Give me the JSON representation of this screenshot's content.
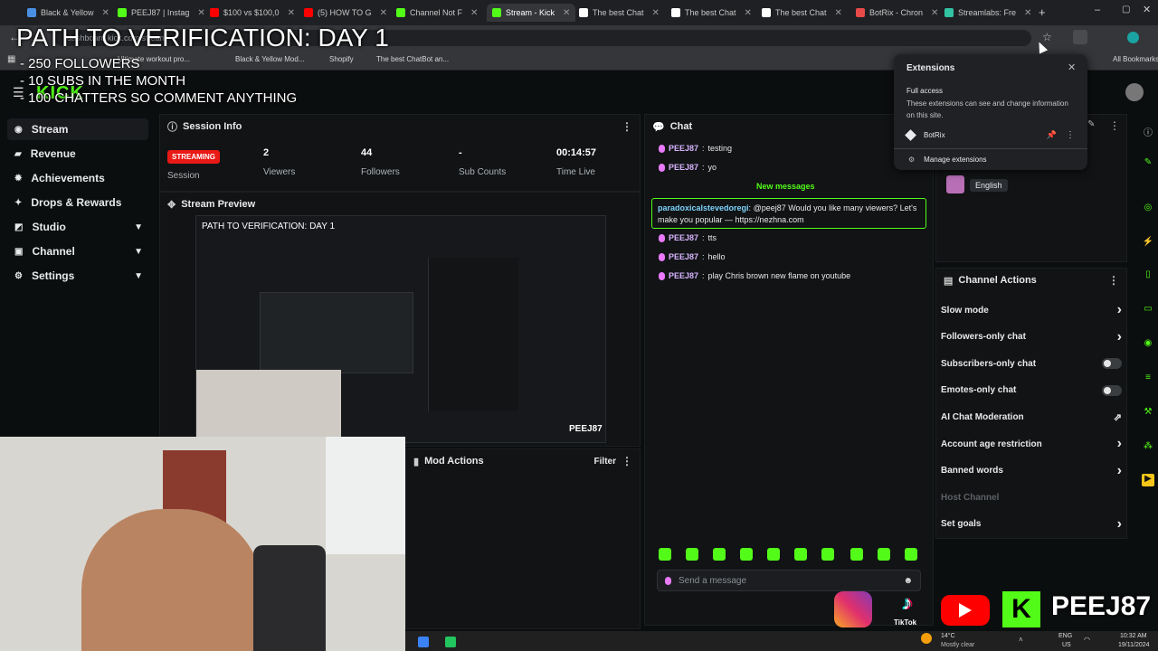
{
  "browser": {
    "tabs": [
      {
        "label": "Black & Yellow",
        "color": "#4a90e2"
      },
      {
        "label": "PEEJ87 | Instag",
        "color": "#53fc18"
      },
      {
        "label": "$100 vs $100,0",
        "color": "#ff0000"
      },
      {
        "label": "(5) HOW TO G",
        "color": "#ff0000"
      },
      {
        "label": "Channel Not F",
        "color": "#53fc18"
      },
      {
        "label": "Stream - Kick",
        "color": "#53fc18",
        "active": true
      },
      {
        "label": "The best Chat",
        "color": "#ffffff"
      },
      {
        "label": "The best Chat",
        "color": "#ffffff"
      },
      {
        "label": "The best Chat",
        "color": "#ffffff"
      },
      {
        "label": "BotRix - Chron",
        "color": "#e84a4a"
      },
      {
        "label": "Streamlabs: Fre",
        "color": "#31c3a2"
      }
    ],
    "url": "dashboard.kick.com/stream",
    "bookmarks": [
      "Ultimate workout pro...",
      "Black & Yellow Mod...",
      "Shopify",
      "The best ChatBot an..."
    ],
    "all_bookmarks": "All Bookmarks"
  },
  "overlay": {
    "title": "PATH TO VERIFICATION: DAY 1",
    "goals": [
      "- 250 FOLLOWERS",
      "- 10 SUBS IN THE MONTH",
      "- 100 CHATTERS SO COMMENT ANYTHING"
    ],
    "social_handle": "PEEJ87",
    "tiktok_label": "TikTok"
  },
  "app": {
    "logo": "KICK"
  },
  "sidebar": {
    "items": [
      {
        "label": "Stream",
        "icon": "stream-icon",
        "active": true
      },
      {
        "label": "Revenue",
        "icon": "revenue-icon"
      },
      {
        "label": "Achievements",
        "icon": "achievements-icon"
      },
      {
        "label": "Drops & Rewards",
        "icon": "drops-icon"
      },
      {
        "label": "Studio",
        "icon": "studio-icon",
        "expandable": true
      },
      {
        "label": "Channel",
        "icon": "channel-icon",
        "expandable": true
      },
      {
        "label": "Settings",
        "icon": "gear-icon",
        "expandable": true
      }
    ]
  },
  "session": {
    "title": "Session Info",
    "status": "STREAMING",
    "status_label": "Session",
    "viewers": "2",
    "viewers_label": "Viewers",
    "followers": "44",
    "followers_label": "Followers",
    "subs": "-",
    "subs_label": "Sub Counts",
    "time": "00:14:57",
    "time_label": "Time Live"
  },
  "preview": {
    "title": "Stream Preview"
  },
  "mod_actions": {
    "title": "Mod Actions",
    "filter": "Filter"
  },
  "chat": {
    "title": "Chat",
    "new_messages": "New messages",
    "messages_before": [
      {
        "user": "PEEJ87",
        "text": "testing"
      },
      {
        "user": "PEEJ87",
        "text": "yo"
      }
    ],
    "highlight": {
      "user": "paradoxicalstevedoregi",
      "text": "@peej87 Would you like many viewers? Let's make you popular — https://nezhna.com"
    },
    "messages_after": [
      {
        "user": "PEEJ87",
        "text": "tts"
      },
      {
        "user": "PEEJ87",
        "text": "hello"
      },
      {
        "user": "PEEJ87",
        "text": "play Chris brown new flame on youtube"
      }
    ],
    "placeholder": "Send a message"
  },
  "channel_actions": {
    "title": "Channel Actions",
    "language": "English",
    "items": [
      {
        "label": "Slow mode",
        "control": "chevron"
      },
      {
        "label": "Followers-only chat",
        "control": "chevron"
      },
      {
        "label": "Subscribers-only chat",
        "control": "toggle"
      },
      {
        "label": "Emotes-only chat",
        "control": "toggle"
      },
      {
        "label": "AI Chat Moderation",
        "control": "external"
      },
      {
        "label": "Account age restriction",
        "control": "chevron"
      },
      {
        "label": "Banned words",
        "control": "chevron"
      },
      {
        "label": "Host Channel",
        "control": "none",
        "disabled": true
      },
      {
        "label": "Set goals",
        "control": "chevron"
      }
    ]
  },
  "extensions_popup": {
    "title": "Extensions",
    "section": "Full access",
    "desc": "These extensions can see and change information on this site.",
    "extension": "BotRix",
    "manage": "Manage extensions"
  },
  "taskbar": {
    "weather_temp": "14°C",
    "weather_desc": "Mostly clear",
    "lang": "ENG",
    "region": "US",
    "time": "10:32 AM",
    "date": "19/11/2024"
  },
  "colors": {
    "accent": "#53fc18",
    "live": "#e91916",
    "highlight_border": "#53fc18"
  }
}
